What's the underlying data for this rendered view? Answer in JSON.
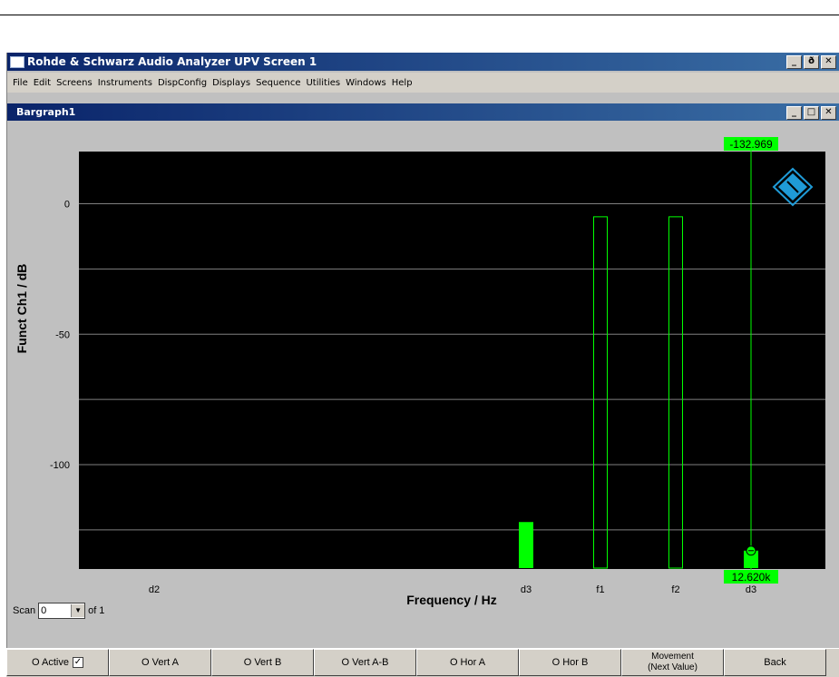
{
  "app": {
    "title": "Rohde & Schwarz Audio Analyzer UPV Screen 1",
    "window_buttons": [
      "_",
      "ð",
      "✕"
    ]
  },
  "menu": [
    "File",
    "Edit",
    "Screens",
    "Instruments",
    "DispConfig",
    "Displays",
    "Sequence",
    "Utilities",
    "Windows",
    "Help"
  ],
  "child_window": {
    "title": "Bargraph1",
    "window_buttons": [
      "_",
      "□",
      "✕"
    ]
  },
  "chart_data": {
    "type": "bar",
    "ylabel": "Funct Ch1 / dB",
    "xlabel": "Frequency / Hz",
    "ylim": [
      -140,
      20
    ],
    "yticks": [
      "0",
      "-50",
      "-100"
    ],
    "ytick_values": [
      0,
      -50,
      -100
    ],
    "grid": true,
    "categories": [
      "d2",
      "d3",
      "f1",
      "f2",
      "d3"
    ],
    "bars": [
      {
        "label": "d2",
        "value": null,
        "style": "none"
      },
      {
        "label": "d3",
        "value": -122,
        "style": "filled"
      },
      {
        "label": "f1",
        "value": -5,
        "style": "outline"
      },
      {
        "label": "f2",
        "value": -5,
        "style": "outline"
      },
      {
        "label": "d3",
        "value": -132.969,
        "style": "filled"
      }
    ],
    "cursor": {
      "value_label": "-132.969",
      "freq_label": "12.620k"
    },
    "colors": {
      "background": "#000000",
      "bar": "#00ff00",
      "grid": "#808080",
      "logo": "#1f9bd7"
    }
  },
  "scan": {
    "label": "Scan",
    "value": "0",
    "of_label": "of 1"
  },
  "softkeys": [
    {
      "label": "O Active",
      "checked": true
    },
    {
      "label": "O Vert A"
    },
    {
      "label": "O Vert B"
    },
    {
      "label": "O Vert A-B"
    },
    {
      "label": "O Hor A"
    },
    {
      "label": "O Hor B"
    },
    {
      "label": "Movement",
      "sub": "(Next Value)"
    },
    {
      "label": "Back"
    }
  ]
}
